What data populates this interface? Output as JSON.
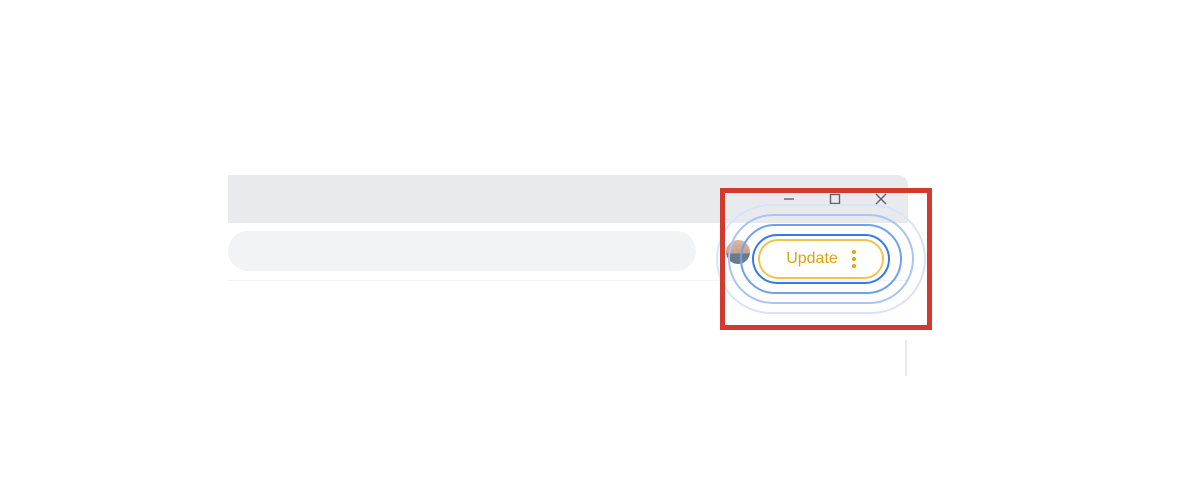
{
  "window": {
    "minimize_label": "Minimize",
    "maximize_label": "Maximize",
    "close_label": "Close"
  },
  "toolbar": {
    "update_label": "Update"
  },
  "colors": {
    "highlight_border": "#d33a2f",
    "update_border": "#f2c24d",
    "update_text": "#e0a20d",
    "ripple_primary": "#357ae8",
    "tab_strip": "#e8eaed",
    "omnibox_bg": "#f1f3f4"
  }
}
